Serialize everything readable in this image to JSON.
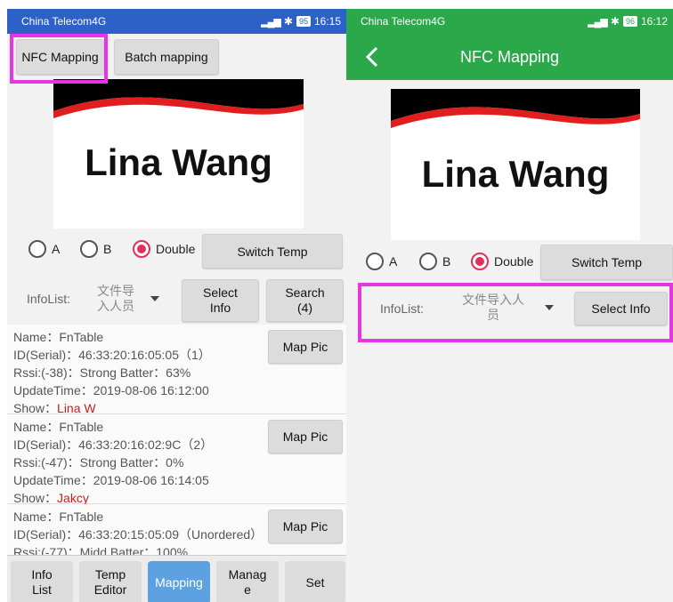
{
  "status": {
    "carrier": "China Telecom4G",
    "time_left": "16:15",
    "time_right": "16:12",
    "battery_left": "95",
    "battery_right": "96"
  },
  "left": {
    "top_buttons": {
      "nfc": "NFC Mapping",
      "batch": "Batch mapping"
    },
    "card_name": "Lina Wang",
    "radio": {
      "a": "A",
      "b": "B",
      "double": "Double",
      "selected": "Double"
    },
    "switch_temp": "Switch Temp",
    "infolist": {
      "label": "InfoList:",
      "value": "文件导入人员",
      "value_line1": "文件导",
      "value_line2": "入人员"
    },
    "select_info": {
      "line1": "Select",
      "line2": "Info"
    },
    "search": {
      "line1": "Search",
      "line2": "(4)"
    },
    "map_pic": "Map Pic",
    "records": [
      {
        "name": "Name：FnTable",
        "id": "ID(Serial)：46:33:20:16:05:05（1）",
        "rssi": "Rssi:(-38)：Strong    Batter：63%",
        "update": "UpdateTime：2019-08-06 16:12:00",
        "show_label": "Show：",
        "show_value": "Lina W"
      },
      {
        "name": "Name：FnTable",
        "id": "ID(Serial)：46:33:20:16:02:9C（2）",
        "rssi": "Rssi:(-47)：Strong    Batter：0%",
        "update": "UpdateTime：2019-08-06 16:14:05",
        "show_label": "Show：",
        "show_value": "Jakcy"
      },
      {
        "name": "Name：FnTable",
        "id": "ID(Serial)：46:33:20:15:05:09（Unordered）",
        "rssi": "Rssi:(-77)：Midd    Batter：100%",
        "update": "",
        "show_label": "",
        "show_value": ""
      }
    ],
    "tabs": [
      {
        "line1": "Info",
        "line2": "List"
      },
      {
        "line1": "Temp",
        "line2": "Editor"
      },
      {
        "line1": "Mapping",
        "line2": ""
      },
      {
        "line1": "Manag",
        "line2": "e"
      },
      {
        "line1": "Set",
        "line2": ""
      }
    ],
    "active_tab": "Mapping"
  },
  "right": {
    "title": "NFC Mapping",
    "card_name": "Lina Wang",
    "radio": {
      "a": "A",
      "b": "B",
      "double": "Double",
      "selected": "Double"
    },
    "switch_temp": "Switch Temp",
    "infolist": {
      "label": "InfoList:",
      "value_line1": "文件导入人",
      "value_line2": "员"
    },
    "select_info": "Select Info"
  },
  "colors": {
    "status_left": "#2d61c7",
    "accent_green": "#2aa84a",
    "radio_selected": "#e2305a",
    "highlight": "#e535e5",
    "active_tab": "#5da2e0",
    "show_text": "#c81e1e"
  }
}
